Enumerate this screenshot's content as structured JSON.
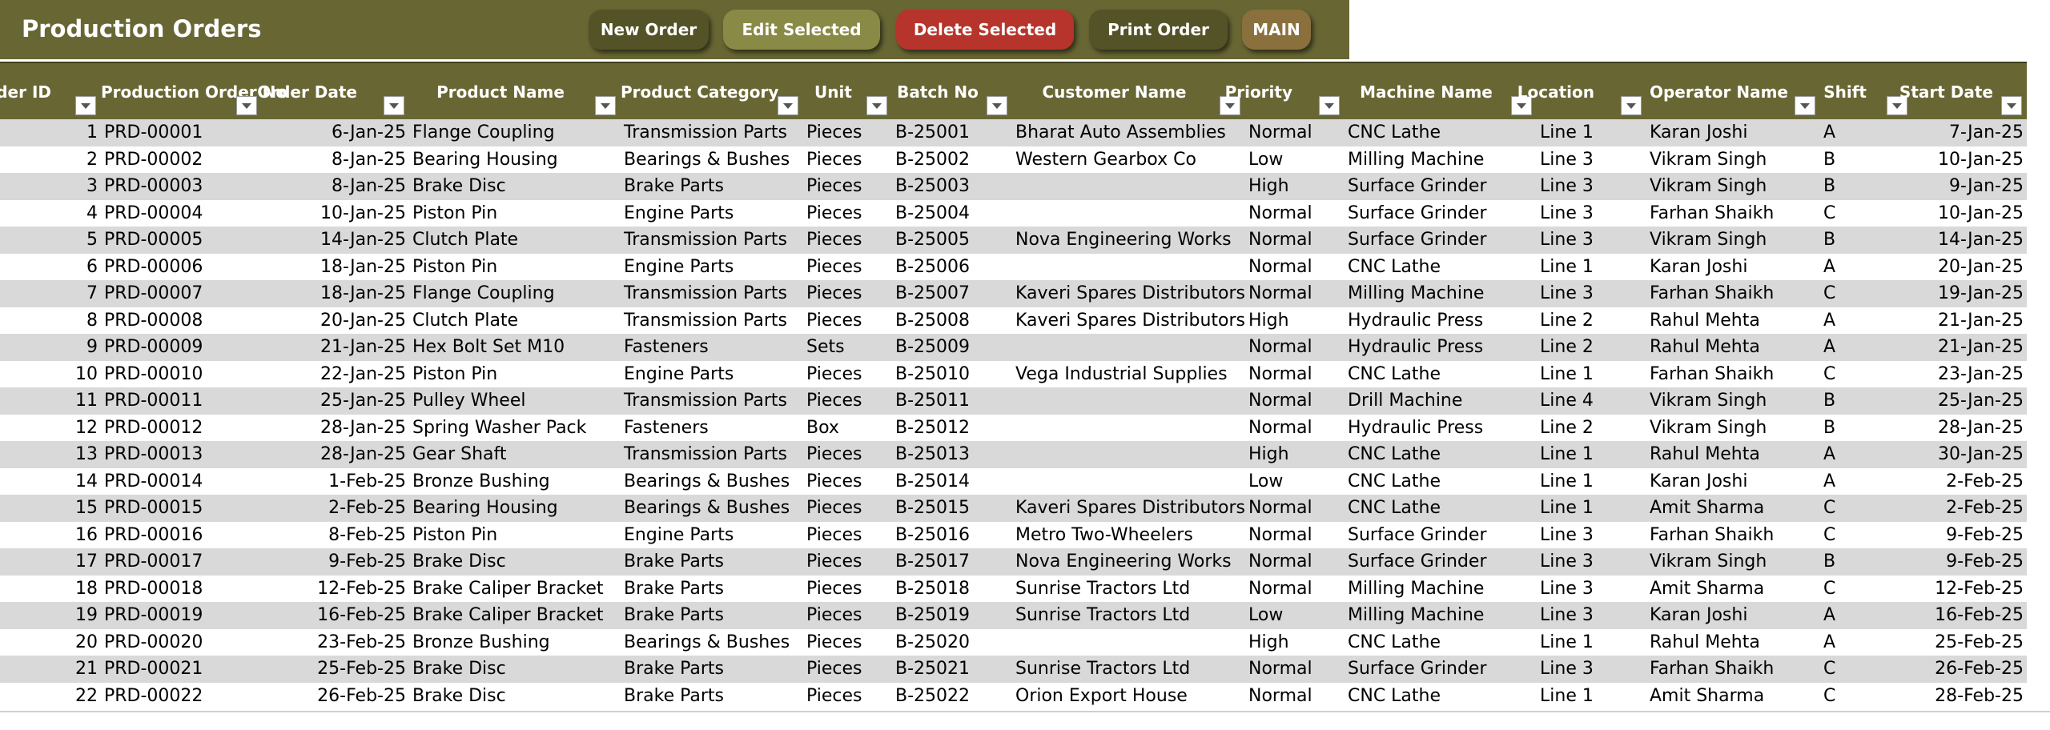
{
  "header": {
    "title": "Production Orders",
    "buttons": {
      "new_order": "New Order",
      "edit_selected": "Edit Selected",
      "delete_selected": "Delete Selected",
      "print_order": "Print Order",
      "main": "MAIN"
    }
  },
  "colors": {
    "header_bg": "#686734",
    "button_dark": "#545327",
    "button_olive": "#8a8a47",
    "button_red": "#b6342b",
    "button_brown": "#8a703c",
    "row_band": "#d9d9d9"
  },
  "table": {
    "columns": [
      "Order ID",
      "Production Order No",
      "Order Date",
      "Product Name",
      "Product Category",
      "Unit",
      "Batch No",
      "Customer Name",
      "Priority",
      "Machine Name",
      "Location",
      "Operator Name",
      "Shift",
      "Start Date"
    ],
    "rows": [
      [
        "1",
        "PRD-00001",
        "6-Jan-25",
        "Flange Coupling",
        "Transmission Parts",
        "Pieces",
        "B-25001",
        "Bharat Auto Assemblies",
        "Normal",
        "CNC Lathe",
        "Line 1",
        "Karan Joshi",
        "A",
        "7-Jan-25"
      ],
      [
        "2",
        "PRD-00002",
        "8-Jan-25",
        "Bearing Housing",
        "Bearings & Bushes",
        "Pieces",
        "B-25002",
        "Western Gearbox Co",
        "Low",
        "Milling Machine",
        "Line 3",
        "Vikram Singh",
        "B",
        "10-Jan-25"
      ],
      [
        "3",
        "PRD-00003",
        "8-Jan-25",
        "Brake Disc",
        "Brake Parts",
        "Pieces",
        "B-25003",
        "",
        "High",
        "Surface Grinder",
        "Line 3",
        "Vikram Singh",
        "B",
        "9-Jan-25"
      ],
      [
        "4",
        "PRD-00004",
        "10-Jan-25",
        "Piston Pin",
        "Engine Parts",
        "Pieces",
        "B-25004",
        "",
        "Normal",
        "Surface Grinder",
        "Line 3",
        "Farhan Shaikh",
        "C",
        "10-Jan-25"
      ],
      [
        "5",
        "PRD-00005",
        "14-Jan-25",
        "Clutch Plate",
        "Transmission Parts",
        "Pieces",
        "B-25005",
        "Nova Engineering Works",
        "Normal",
        "Surface Grinder",
        "Line 3",
        "Vikram Singh",
        "B",
        "14-Jan-25"
      ],
      [
        "6",
        "PRD-00006",
        "18-Jan-25",
        "Piston Pin",
        "Engine Parts",
        "Pieces",
        "B-25006",
        "",
        "Normal",
        "CNC Lathe",
        "Line 1",
        "Karan Joshi",
        "A",
        "20-Jan-25"
      ],
      [
        "7",
        "PRD-00007",
        "18-Jan-25",
        "Flange Coupling",
        "Transmission Parts",
        "Pieces",
        "B-25007",
        "Kaveri Spares Distributors",
        "Normal",
        "Milling Machine",
        "Line 3",
        "Farhan Shaikh",
        "C",
        "19-Jan-25"
      ],
      [
        "8",
        "PRD-00008",
        "20-Jan-25",
        "Clutch Plate",
        "Transmission Parts",
        "Pieces",
        "B-25008",
        "Kaveri Spares Distributors",
        "High",
        "Hydraulic Press",
        "Line 2",
        "Rahul Mehta",
        "A",
        "21-Jan-25"
      ],
      [
        "9",
        "PRD-00009",
        "21-Jan-25",
        "Hex Bolt Set M10",
        "Fasteners",
        "Sets",
        "B-25009",
        "",
        "Normal",
        "Hydraulic Press",
        "Line 2",
        "Rahul Mehta",
        "A",
        "21-Jan-25"
      ],
      [
        "10",
        "PRD-00010",
        "22-Jan-25",
        "Piston Pin",
        "Engine Parts",
        "Pieces",
        "B-25010",
        "Vega Industrial Supplies",
        "Normal",
        "CNC Lathe",
        "Line 1",
        "Farhan Shaikh",
        "C",
        "23-Jan-25"
      ],
      [
        "11",
        "PRD-00011",
        "25-Jan-25",
        "Pulley Wheel",
        "Transmission Parts",
        "Pieces",
        "B-25011",
        "",
        "Normal",
        "Drill Machine",
        "Line 4",
        "Vikram Singh",
        "B",
        "25-Jan-25"
      ],
      [
        "12",
        "PRD-00012",
        "28-Jan-25",
        "Spring Washer Pack",
        "Fasteners",
        "Box",
        "B-25012",
        "",
        "Normal",
        "Hydraulic Press",
        "Line 2",
        "Vikram Singh",
        "B",
        "28-Jan-25"
      ],
      [
        "13",
        "PRD-00013",
        "28-Jan-25",
        "Gear Shaft",
        "Transmission Parts",
        "Pieces",
        "B-25013",
        "",
        "High",
        "CNC Lathe",
        "Line 1",
        "Rahul Mehta",
        "A",
        "30-Jan-25"
      ],
      [
        "14",
        "PRD-00014",
        "1-Feb-25",
        "Bronze Bushing",
        "Bearings & Bushes",
        "Pieces",
        "B-25014",
        "",
        "Low",
        "CNC Lathe",
        "Line 1",
        "Karan Joshi",
        "A",
        "2-Feb-25"
      ],
      [
        "15",
        "PRD-00015",
        "2-Feb-25",
        "Bearing Housing",
        "Bearings & Bushes",
        "Pieces",
        "B-25015",
        "Kaveri Spares Distributors",
        "Normal",
        "CNC Lathe",
        "Line 1",
        "Amit Sharma",
        "C",
        "2-Feb-25"
      ],
      [
        "16",
        "PRD-00016",
        "8-Feb-25",
        "Piston Pin",
        "Engine Parts",
        "Pieces",
        "B-25016",
        "Metro Two-Wheelers",
        "Normal",
        "Surface Grinder",
        "Line 3",
        "Farhan Shaikh",
        "C",
        "9-Feb-25"
      ],
      [
        "17",
        "PRD-00017",
        "9-Feb-25",
        "Brake Disc",
        "Brake Parts",
        "Pieces",
        "B-25017",
        "Nova Engineering Works",
        "Normal",
        "Surface Grinder",
        "Line 3",
        "Vikram Singh",
        "B",
        "9-Feb-25"
      ],
      [
        "18",
        "PRD-00018",
        "12-Feb-25",
        "Brake Caliper Bracket",
        "Brake Parts",
        "Pieces",
        "B-25018",
        "Sunrise Tractors Ltd",
        "Normal",
        "Milling Machine",
        "Line 3",
        "Amit Sharma",
        "C",
        "12-Feb-25"
      ],
      [
        "19",
        "PRD-00019",
        "16-Feb-25",
        "Brake Caliper Bracket",
        "Brake Parts",
        "Pieces",
        "B-25019",
        "Sunrise Tractors Ltd",
        "Low",
        "Milling Machine",
        "Line 3",
        "Karan Joshi",
        "A",
        "16-Feb-25"
      ],
      [
        "20",
        "PRD-00020",
        "23-Feb-25",
        "Bronze Bushing",
        "Bearings & Bushes",
        "Pieces",
        "B-25020",
        "",
        "High",
        "CNC Lathe",
        "Line 1",
        "Rahul Mehta",
        "A",
        "25-Feb-25"
      ],
      [
        "21",
        "PRD-00021",
        "25-Feb-25",
        "Brake Disc",
        "Brake Parts",
        "Pieces",
        "B-25021",
        "Sunrise Tractors Ltd",
        "Normal",
        "Surface Grinder",
        "Line 3",
        "Farhan Shaikh",
        "C",
        "26-Feb-25"
      ],
      [
        "22",
        "PRD-00022",
        "26-Feb-25",
        "Brake Disc",
        "Brake Parts",
        "Pieces",
        "B-25022",
        "Orion Export House",
        "Normal",
        "CNC Lathe",
        "Line 1",
        "Amit Sharma",
        "C",
        "28-Feb-25"
      ]
    ]
  }
}
